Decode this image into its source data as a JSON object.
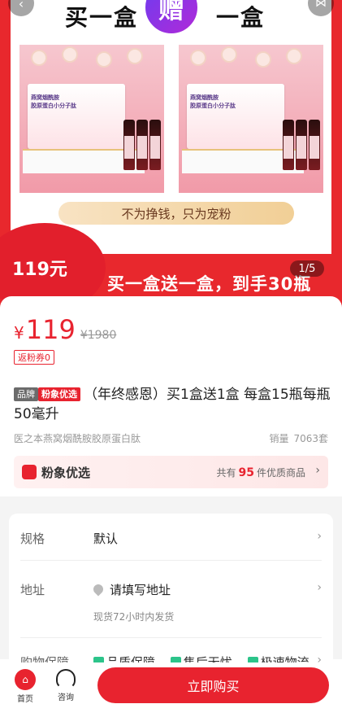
{
  "hero": {
    "title_left": "买一盒",
    "gift_char": "赠",
    "title_right": "一盒",
    "product_box_text": "燕窝烟酰胺\n胶原蛋白小分子肽",
    "slogan": "不为挣钱，只为宠粉",
    "price_badge": "119元",
    "promo_banner": "买一盒送一盒，到手30瓶",
    "page_indicator": "1/5",
    "back_icon": "back-icon",
    "share_icon": "share-icon"
  },
  "product": {
    "currency": "¥",
    "price": "119",
    "original_price": "¥1980",
    "coupon": "返粉券0",
    "tag_brand": "品牌",
    "tag_select": "粉象优选",
    "title": "（年终感恩）买1盒送1盒 每盒15瓶每瓶50毫升",
    "subtitle": "医之本燕窝烟酰胺胶原蛋白肽",
    "sales_label": "销量",
    "sales_value": "7063套"
  },
  "store": {
    "name": "粉象优选",
    "count_prefix": "共有",
    "count": "95",
    "count_suffix": "件优质商品",
    "arrow": "›"
  },
  "spec": {
    "spec_label": "规格",
    "spec_value": "默认",
    "address_label": "地址",
    "address_value": "请填写地址",
    "ship_note": "现货72小时内发货",
    "guarantee_label": "购物保障",
    "guarantees": [
      "品质保障",
      "售后无忧",
      "极速物流"
    ],
    "arrow": "›"
  },
  "bottom": {
    "home_label": "首页",
    "consult_label": "咨询",
    "buy_label": "立即购买"
  },
  "colors": {
    "primary": "#e8232f",
    "gold": "#f1cf96"
  }
}
